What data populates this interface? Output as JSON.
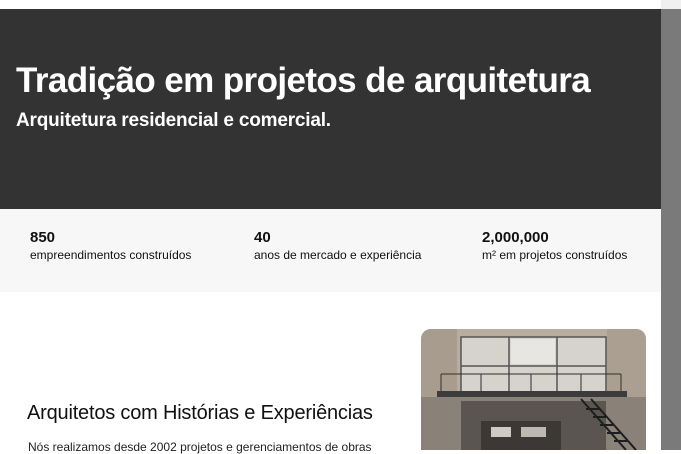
{
  "hero": {
    "title": "Tradição em projetos de arquitetura",
    "subtitle": "Arquitetura residencial e comercial."
  },
  "stats": [
    {
      "value": "850",
      "label": "empreendimentos construídos"
    },
    {
      "value": "40",
      "label": "anos de mercado e experiência"
    },
    {
      "value": "2,000,000",
      "label": "m² em projetos construídos"
    }
  ],
  "about": {
    "heading": "Arquitetos com Histórias e Experiências",
    "text": "Nós realizamos desde 2002 projetos e gerenciamentos de obras"
  },
  "colors": {
    "hero_bg": "#333333",
    "stats_bg": "#f7f7f7",
    "scrollbar": "#7a7a7a"
  }
}
